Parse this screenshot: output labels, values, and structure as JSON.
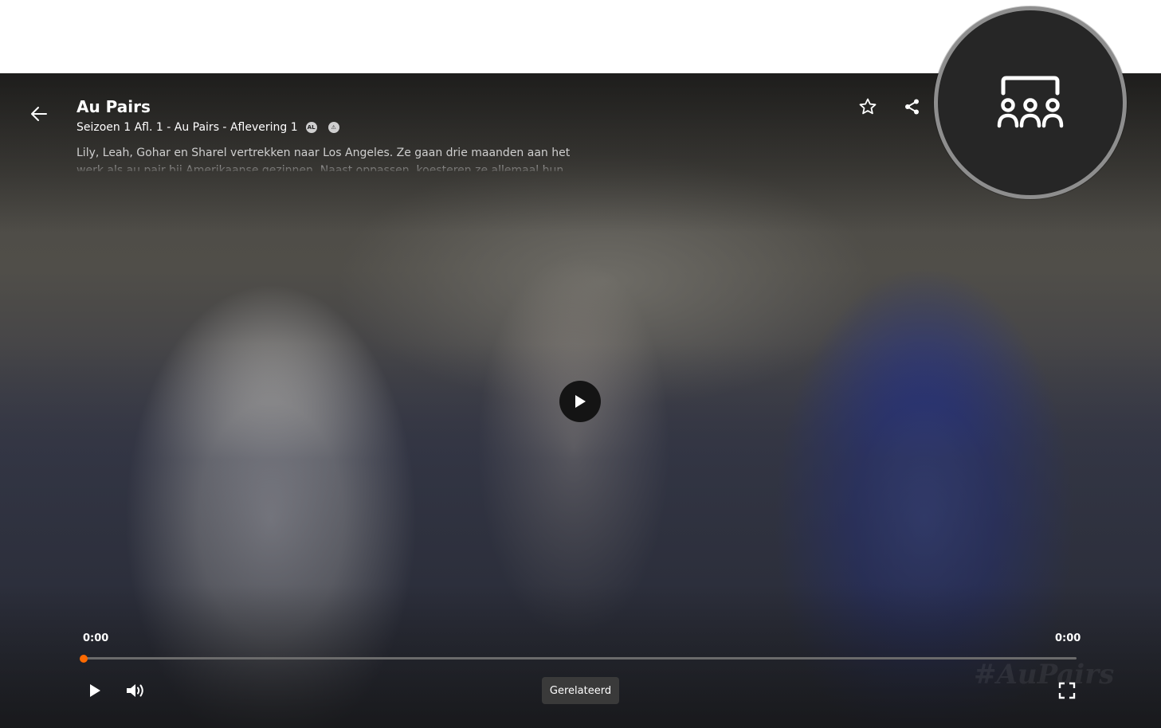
{
  "player": {
    "title": "Au Pairs",
    "subtitle": "Seizoen 1 Afl. 1 - Au Pairs - Aflevering 1",
    "rating_badges": [
      "AL",
      "⚠"
    ],
    "description": "Lily, Leah, Gohar en Sharel vertrekken naar Los Angeles. Ze gaan drie maanden aan het werk als au pair bij Amerikaanse gezinnen. Naast oppassen, koesteren ze allemaal hun eigen",
    "time_current": "0:00",
    "time_total": "0:00",
    "progress_fraction": 0.0,
    "related_label": "Gerelateerd",
    "watermark": "#AuPairs",
    "accent_color": "#ff6a00"
  },
  "icons": {
    "back": "arrow-left-icon",
    "favorite": "star-icon",
    "share": "share-icon",
    "center_play": "play-icon",
    "play": "play-icon",
    "volume": "volume-icon",
    "fullscreen": "fullscreen-icon",
    "watch_party": "watch-party-icon"
  }
}
